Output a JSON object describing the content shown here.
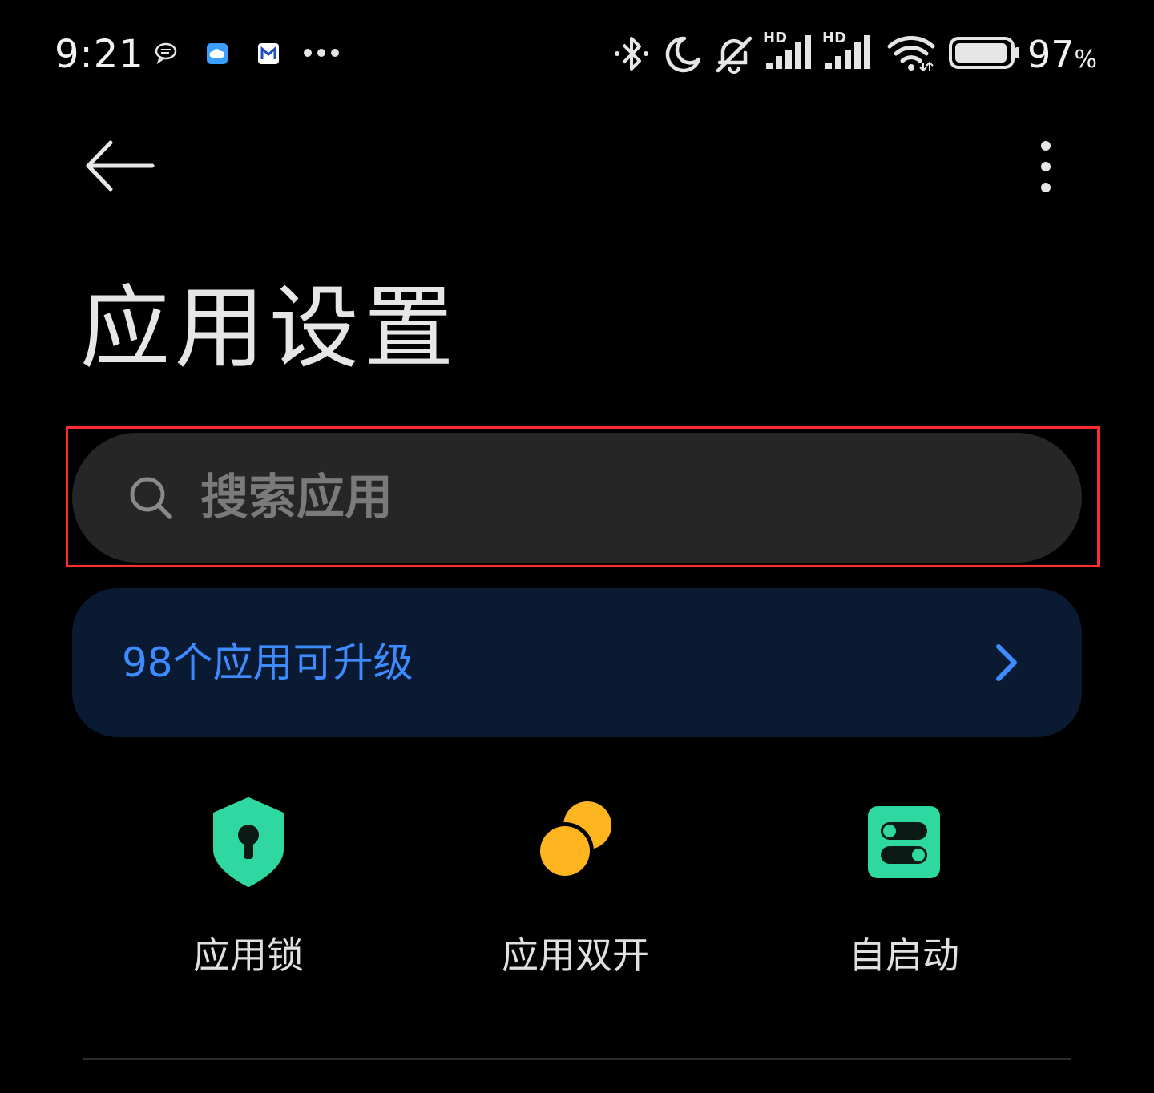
{
  "status_bar": {
    "time": "9:21",
    "battery_value": "97",
    "battery_unit": "%",
    "icons": [
      "chat-bubble-icon",
      "cloud-app-icon",
      "mail-app-icon",
      "more-notifications-icon",
      "bluetooth-icon",
      "do-not-disturb-moon-icon",
      "silent-bell-icon",
      "hd-signal-icon",
      "hd-signal-icon",
      "wifi-icon",
      "battery-icon"
    ],
    "hd_label": "HD",
    "battery_level": 0.97
  },
  "header": {
    "back_icon": "arrow-left-icon",
    "more_icon": "vertical-dots-icon",
    "title": "应用设置"
  },
  "search": {
    "icon": "search-icon",
    "placeholder": "搜索应用",
    "value": ""
  },
  "upgrade_banner": {
    "text": "98个应用可升级",
    "icon": "chevron-right-icon",
    "accent": "#3d8bff"
  },
  "quick_tiles": [
    {
      "label": "应用锁",
      "icon": "shield-lock-icon",
      "color": "#2fd8a0"
    },
    {
      "label": "应用双开",
      "icon": "dual-circles-icon",
      "color": "#ffb51f"
    },
    {
      "label": "自启动",
      "icon": "toggle-switches-icon",
      "color": "#2fd8a0"
    }
  ]
}
